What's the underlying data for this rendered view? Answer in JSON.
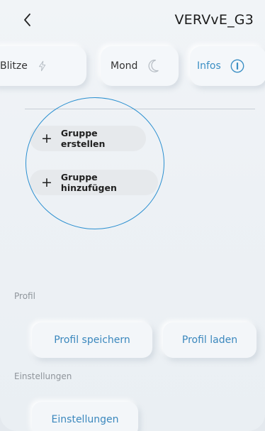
{
  "header": {
    "device_name": "VERVvE_G3",
    "back_icon": "chevron-left-icon"
  },
  "tabs": [
    {
      "label": "Blitze",
      "icon": "lightning-icon"
    },
    {
      "label": "Mond",
      "icon": "moon-icon"
    },
    {
      "label": "Infos",
      "icon": "info-icon",
      "accent": "#3b8fc4"
    }
  ],
  "groups": {
    "create_label": "Gruppe erstellen",
    "add_label": "Gruppe hinzufügen",
    "highlight_color": "#2a8fd0"
  },
  "profile": {
    "section_label": "Profil",
    "save_label": "Profil speichern",
    "load_label": "Profil laden"
  },
  "settings": {
    "section_label": "Einstellungen",
    "button_label": "Einstellungen"
  },
  "colors": {
    "accent_text": "#3a87bd",
    "background": "#eef2f6"
  }
}
